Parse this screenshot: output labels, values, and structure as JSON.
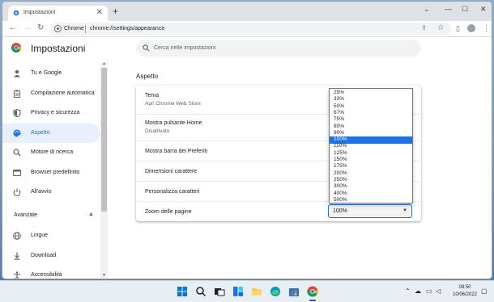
{
  "browser": {
    "tab_title": "Impostazioni",
    "tab_close": "✕",
    "new_tab": "+",
    "window_controls": {
      "chevron": "⌄",
      "minimize": "—",
      "maximize": "☐",
      "close": "✕"
    },
    "nav": {
      "back": "←",
      "forward": "→",
      "reload": "↻"
    },
    "omnibox": {
      "host": "Chrome",
      "url": "chrome://settings/appearance"
    }
  },
  "header": {
    "title": "Impostazioni",
    "search_placeholder": "Cerca nelle impostazioni"
  },
  "sidebar": {
    "items": [
      {
        "label": "Tu e Google",
        "icon": "person-icon",
        "active": false
      },
      {
        "label": "Compilazione automatica",
        "icon": "clipboard-icon",
        "active": false
      },
      {
        "label": "Privacy e sicurezza",
        "icon": "shield-icon",
        "active": false
      },
      {
        "label": "Aspetto",
        "icon": "palette-icon",
        "active": true
      },
      {
        "label": "Motore di ricerca",
        "icon": "search-icon",
        "active": false
      },
      {
        "label": "Browser predefinito",
        "icon": "browser-icon",
        "active": false
      },
      {
        "label": "All'avvio",
        "icon": "power-icon",
        "active": false
      }
    ],
    "advanced": {
      "label": "Avanzate",
      "chevron": "▲"
    },
    "advanced_items": [
      {
        "label": "Lingue",
        "icon": "globe-icon"
      },
      {
        "label": "Download",
        "icon": "download-icon"
      },
      {
        "label": "Accessibilità",
        "icon": "accessibility-icon"
      }
    ]
  },
  "main": {
    "section_title": "Aspetto",
    "rows": [
      {
        "label": "Tema",
        "sub": "Apri Chrome Web Store",
        "external": true
      },
      {
        "label": "Mostra pulsante Home",
        "sub": "Disattivato",
        "external": false
      },
      {
        "label": "Mostra barra dei Preferiti",
        "sub": "",
        "external": false
      },
      {
        "label": "Dimensioni carattere",
        "sub": "",
        "external": false
      },
      {
        "label": "Personalizza caratteri",
        "sub": "",
        "external": false
      },
      {
        "label": "Zoom delle pagine",
        "sub": "",
        "external": false
      }
    ],
    "zoom": {
      "selected": "100%",
      "options": [
        "25%",
        "33%",
        "50%",
        "67%",
        "75%",
        "80%",
        "90%",
        "100%",
        "110%",
        "125%",
        "150%",
        "175%",
        "200%",
        "250%",
        "300%",
        "400%",
        "500%"
      ]
    }
  },
  "taskbar": {
    "apps": [
      "windows-start-icon",
      "search-icon",
      "task-view-icon",
      "widgets-icon",
      "file-explorer-icon",
      "edge-icon",
      "store-icon",
      "chrome-icon"
    ],
    "tray": {
      "chevron": "⌃"
    },
    "time": "08:50",
    "date": "10/06/2022"
  },
  "colors": {
    "accent": "#1a73e8",
    "active_bg": "#e8f0fe"
  }
}
